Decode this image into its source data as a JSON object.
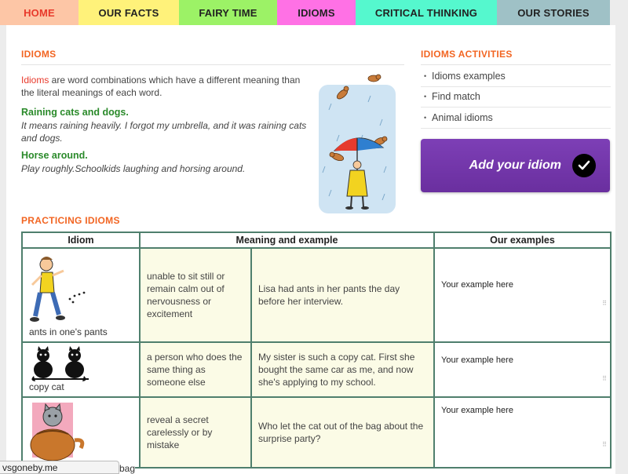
{
  "nav": {
    "tabs": [
      {
        "label": "HOME",
        "bg": "#fdc6a6",
        "color": "#e8392b"
      },
      {
        "label": "OUR FACTS",
        "bg": "#fff27a",
        "color": "#222"
      },
      {
        "label": "FAIRY TIME",
        "bg": "#9cf266",
        "color": "#222"
      },
      {
        "label": "IDIOMS",
        "bg": "#ff71e5",
        "color": "#222"
      },
      {
        "label": "CRITICAL THINKING",
        "bg": "#55f8ce",
        "color": "#222"
      },
      {
        "label": "OUR STORIES",
        "bg": "#9fc1c6",
        "color": "#222"
      }
    ]
  },
  "intro": {
    "title": "IDIOMS",
    "keyword": "Idioms",
    "text": " are word combinations which have a different meaning than the literal meanings of each word.",
    "examples": [
      {
        "heading": "Raining cats and dogs.",
        "desc": "It means raining heavily. I forgot my umbrella, and it was raining cats and dogs."
      },
      {
        "heading": "Horse around.",
        "desc": "Play roughly.Schoolkids laughing and horsing around."
      }
    ]
  },
  "activities": {
    "title": "IDIOMS ACTIVITIES",
    "items": [
      "Idioms examples",
      "Find match",
      "Animal idioms"
    ],
    "add_button": "Add your idiom"
  },
  "practice": {
    "title": "PRACTICING IDIOMS",
    "headers": [
      "Idiom",
      "Meaning and example",
      "Our examples"
    ],
    "rows": [
      {
        "idiom": "ants in one's pants",
        "meaning": "unable to sit still or remain calm out of nervousness or excitement",
        "example": "Lisa had ants in her pants the day before her interview.",
        "ours": "Your example here"
      },
      {
        "idiom": "copy cat",
        "meaning": "a person who does the same thing as someone else",
        "example": "My sister is such a copy cat. First she bought the same car as me, and now she's applying to my school.",
        "ours": "Your example here"
      },
      {
        "idiom": "let the cat out of the bag",
        "meaning": "reveal a secret carelessly or by mistake",
        "example": "Who let the cat out of the bag about the surprise party?",
        "ours": "Your example here"
      }
    ]
  },
  "status_bar": {
    "text": "vsgoneby.me"
  }
}
